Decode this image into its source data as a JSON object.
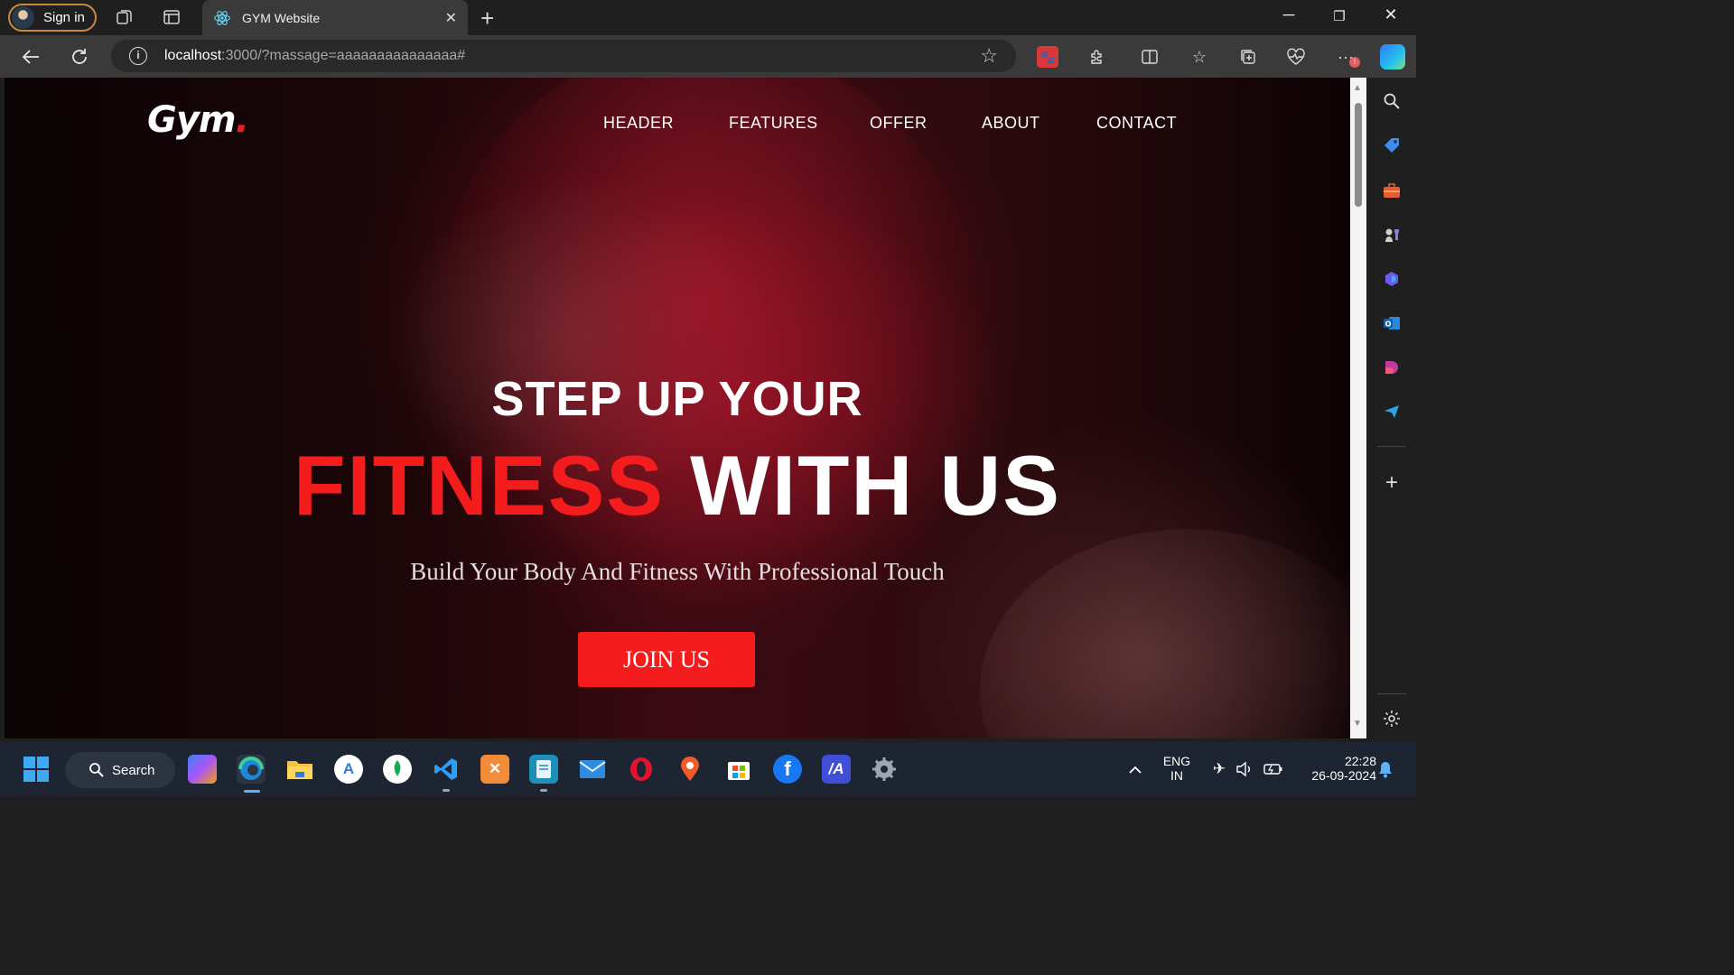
{
  "browser": {
    "profile_label": "Sign in",
    "tab_title": "GYM Website",
    "url_host": "localhost",
    "url_rest": ":3000/?massage=aaaaaaaaaaaaaaa#"
  },
  "site": {
    "logo_text": "Gym",
    "logo_dot": ".",
    "nav": [
      "HEADER",
      "FEATURES",
      "OFFER",
      "ABOUT",
      "CONTACT"
    ],
    "hero_line1": "STEP UP YOUR",
    "hero_red": "FITNESS",
    "hero_white": "WITH US",
    "subtitle": "Build Your Body And Fitness With Professional Touch",
    "cta": "JOIN US",
    "accent_color": "#f41c1c"
  },
  "taskbar": {
    "search_label": "Search",
    "lang_top": "ENG",
    "lang_bottom": "IN",
    "time": "22:28",
    "date": "26-09-2024"
  }
}
